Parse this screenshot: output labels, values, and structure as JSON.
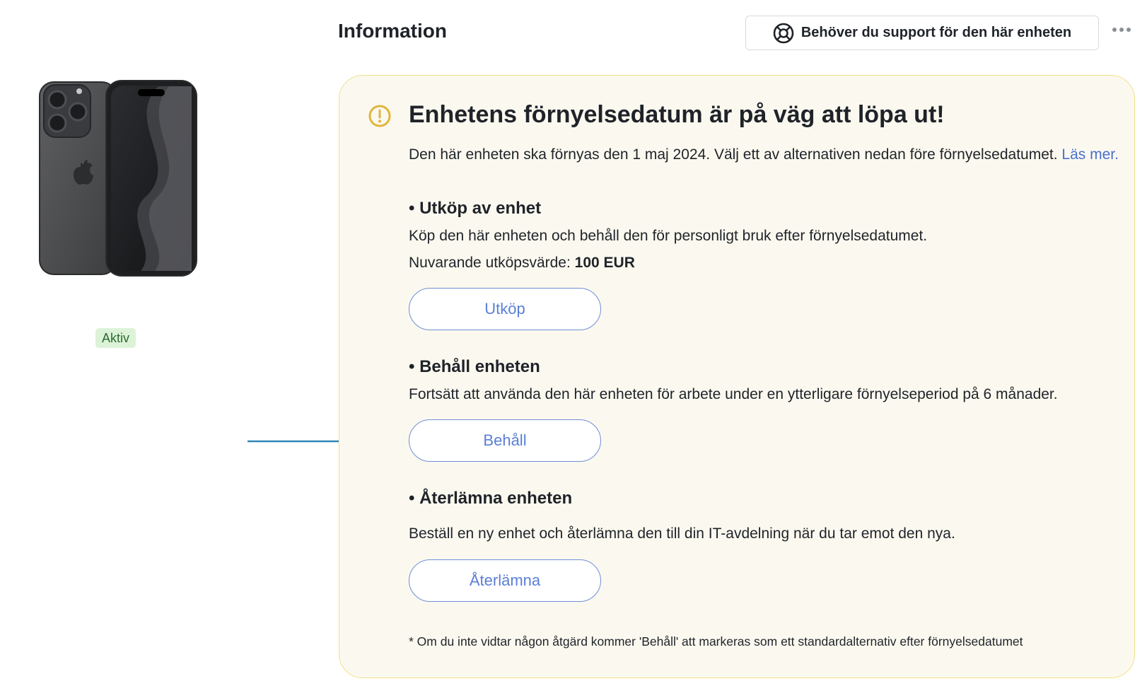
{
  "header": {
    "title": "Information",
    "support_button_label": "Behöver du support för den här enheten",
    "support_icon": "lifebuoy-icon",
    "more_icon": "more-horizontal-icon"
  },
  "device": {
    "image": "iphone-image",
    "status": "Aktiv"
  },
  "notice": {
    "icon": "warning-circle-icon",
    "title": "Enhetens förnyelsedatum är på väg att löpa ut!",
    "intro": "Den här enheten ska förnyas den 1 maj 2024. Välj ett av alternativen nedan före förnyelsedatumet.",
    "read_more": "Läs mer.",
    "buyout": {
      "title": "• Utköp av enhet",
      "description": "Köp den här enheten och behåll den för personligt bruk efter förnyelsedatumet.",
      "value_label": "Nuvarande utköpsvärde:",
      "value": "100 EUR",
      "button": "Utköp"
    },
    "keep": {
      "title": "• Behåll enheten",
      "description": "Fortsätt att använda den här enheten för arbete under en ytterligare förnyelseperiod på 6 månader.",
      "button": "Behåll"
    },
    "return": {
      "title": "• Återlämna enheten",
      "description": "Beställ en ny enhet och återlämna den till din IT-avdelning när du tar emot den nya.",
      "button": "Återlämna"
    },
    "footnote": "* Om du inte vidtar någon åtgärd kommer 'Behåll' att markeras som ett standardalternativ efter förnyelsedatumet"
  },
  "colors": {
    "card_background": "#fbf9ef",
    "card_border": "#efe18a",
    "warning": "#e2b43c",
    "link": "#4a6fd0",
    "badge_background": "#dcf3d8",
    "badge_text": "#2c6b32",
    "arrow": "#2f86b8"
  }
}
